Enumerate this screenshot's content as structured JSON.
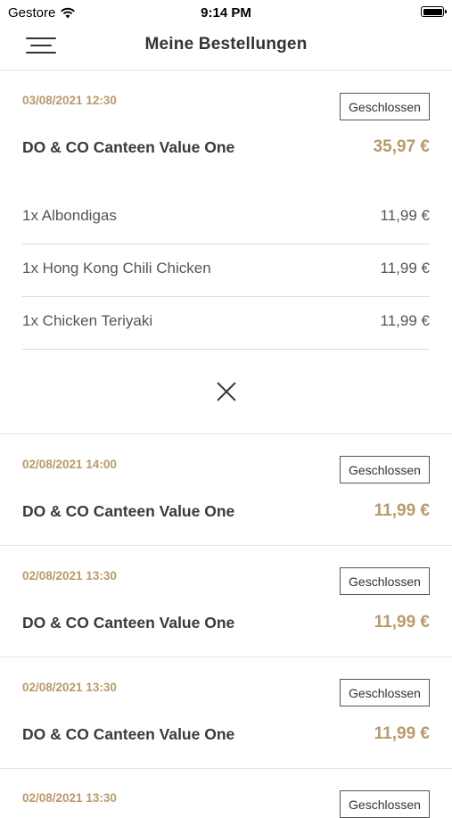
{
  "status_bar": {
    "carrier": "Gestore",
    "time": "9:14 PM"
  },
  "header": {
    "title": "Meine Bestellungen"
  },
  "orders": [
    {
      "date": "03/08/2021 12:30",
      "status": "Geschlossen",
      "name": "DO & CO Canteen Value One",
      "total": "35,97 €",
      "items": [
        {
          "name": "1x Albondigas",
          "price": "11,99 €"
        },
        {
          "name": "1x Hong Kong Chili Chicken",
          "price": "11,99 €"
        },
        {
          "name": "1x Chicken Teriyaki",
          "price": "11,99 €"
        }
      ]
    },
    {
      "date": "02/08/2021 14:00",
      "status": "Geschlossen",
      "name": "DO & CO Canteen Value One",
      "total": "11,99 €"
    },
    {
      "date": "02/08/2021 13:30",
      "status": "Geschlossen",
      "name": "DO & CO Canteen Value One",
      "total": "11,99 €"
    },
    {
      "date": "02/08/2021 13:30",
      "status": "Geschlossen",
      "name": "DO & CO Canteen Value One",
      "total": "11,99 €"
    },
    {
      "date": "02/08/2021 13:30",
      "status": "Geschlossen"
    }
  ]
}
